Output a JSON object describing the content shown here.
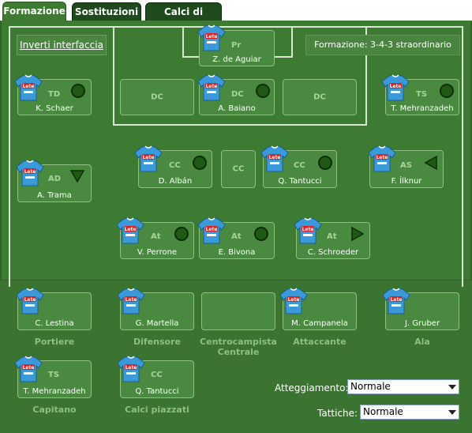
{
  "tabs": [
    {
      "label": "Formazione",
      "active": true
    },
    {
      "label": "Sostituzioni",
      "active": false
    },
    {
      "label": "Calci di Rigore",
      "active": false
    }
  ],
  "toolbar": {
    "invert_label": "Inverti interfaccia",
    "formation_text": "Formazione: 3-4-3 straordinario"
  },
  "players": {
    "gk": {
      "name": "Z. de Aguiar",
      "pos": "Pr"
    },
    "ts_left": {
      "name": "K. Schaer",
      "pos": "TD"
    },
    "dc_mid": {
      "name": "A. Baiano",
      "pos": "DC"
    },
    "ts_right": {
      "name": "T. Mehranzadeh",
      "pos": "TS"
    },
    "ad": {
      "name": "A. Trama",
      "pos": "AD"
    },
    "cc1": {
      "name": "D. Albán",
      "pos": "CC"
    },
    "cc3": {
      "name": "Q. Tantucci",
      "pos": "CC"
    },
    "as": {
      "name": "F. İlknur",
      "pos": "AS"
    },
    "at1": {
      "name": "V. Perrone",
      "pos": "At"
    },
    "at2": {
      "name": "E. Bivona",
      "pos": "At"
    },
    "at3": {
      "name": "C. Schroeder",
      "pos": "At"
    }
  },
  "empty_slots": {
    "dc_left": "DC",
    "dc_right": "DC",
    "cc_empty": "CC"
  },
  "bench": {
    "portiere": {
      "name": "C. Lestina",
      "label": "Portiere"
    },
    "difensore": {
      "name": "G. Martella",
      "label": "Difensore"
    },
    "centrocampista": {
      "name": "",
      "label_1": "Centrocampista",
      "label_2": "Centrale"
    },
    "attaccante": {
      "name": "M. Campanela",
      "label": "Attaccante"
    },
    "ala": {
      "name": "J. Gruber",
      "label": "Ala"
    },
    "capitano": {
      "name": "T. Mehranzadeh",
      "pos": "TS",
      "label": "Capitano"
    },
    "calci": {
      "name": "Q. Tantucci",
      "pos": "CC",
      "label": "Calci piazzati"
    }
  },
  "settings": {
    "atteggiamento_label": "Atteggiamento:",
    "atteggiamento_value": "Normale",
    "tattiche_label": "Tattiche:",
    "tattiche_value": "Normale"
  },
  "colors": {
    "pitch": "#3d7a32",
    "shirt": "#3a9ad9",
    "indicator": "#1f5a14"
  }
}
